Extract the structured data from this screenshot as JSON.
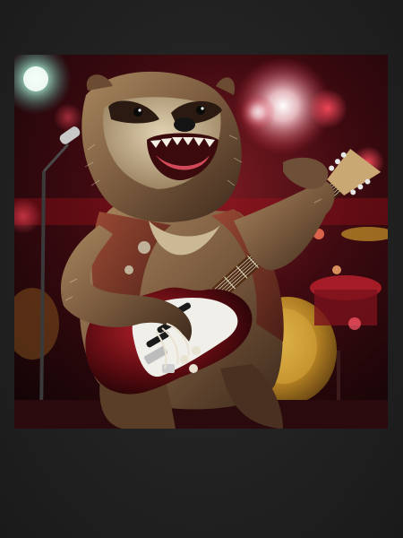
{
  "image": {
    "subject": "sloth-guitarist",
    "colors": {
      "backdrop": "#232323",
      "stage_red": "#b3141e",
      "fur": "#8a6a4c",
      "guitar_body": "#6e0d12",
      "pickguard": "#f1efe9",
      "drum_gold": "#c9962a"
    }
  }
}
